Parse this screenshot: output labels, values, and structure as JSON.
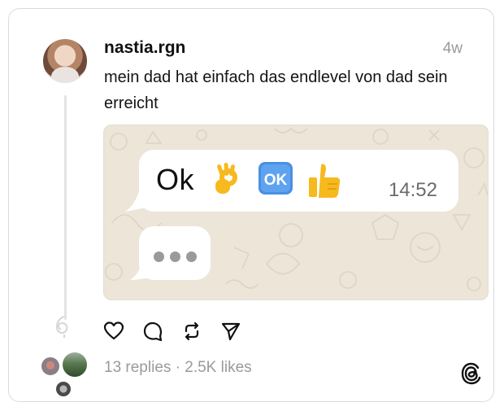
{
  "post": {
    "username": "nastia.rgn",
    "time_ago": "4w",
    "text": "mein dad hat einfach das endlevel von dad sein erreicht"
  },
  "chat_screenshot": {
    "message_text": "Ok",
    "emojis": [
      "ok-hand-emoji",
      "ok-button-emoji",
      "thumbs-up-emoji"
    ],
    "message_time": "14:52",
    "typing_indicator_dots": 3
  },
  "actions": [
    "heart-icon",
    "comment-icon",
    "repost-icon",
    "share-icon"
  ],
  "stats": {
    "text": "13 replies · 2.5K likes"
  },
  "colors": {
    "wallpaper": "#ece5d8",
    "bubble": "#ffffff",
    "muted_text": "#9a9a9a",
    "emoji_yellow": "#f6b91e",
    "ok_button_blue": "#4a90e2"
  }
}
